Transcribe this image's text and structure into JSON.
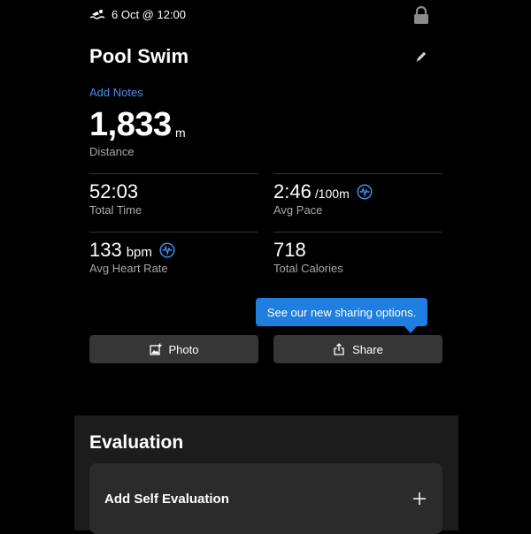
{
  "status": {
    "date_time": "6 Oct @ 12:00"
  },
  "activity": {
    "title": "Pool Swim",
    "add_notes": "Add Notes",
    "distance": {
      "value": "1,833",
      "unit": "m",
      "label": "Distance"
    },
    "stats": {
      "total_time": {
        "value": "52:03",
        "label": "Total Time"
      },
      "avg_pace": {
        "value": "2:46",
        "unit": "/100m",
        "label": "Avg Pace"
      },
      "avg_hr": {
        "value": "133",
        "unit": "bpm",
        "label": "Avg Heart Rate"
      },
      "calories": {
        "value": "718",
        "label": "Total Calories"
      }
    }
  },
  "actions": {
    "tooltip": "See our new sharing options.",
    "photo_label": "Photo",
    "share_label": "Share"
  },
  "evaluation": {
    "title": "Evaluation",
    "add_label": "Add Self Evaluation"
  },
  "colors": {
    "accent": "#1f7ee0",
    "link": "#4a8fe8",
    "button": "#363636"
  },
  "icons": [
    "swim-icon",
    "lock-icon",
    "pencil-icon",
    "heart-rate-icon",
    "photo-icon",
    "share-icon",
    "plus-icon"
  ]
}
